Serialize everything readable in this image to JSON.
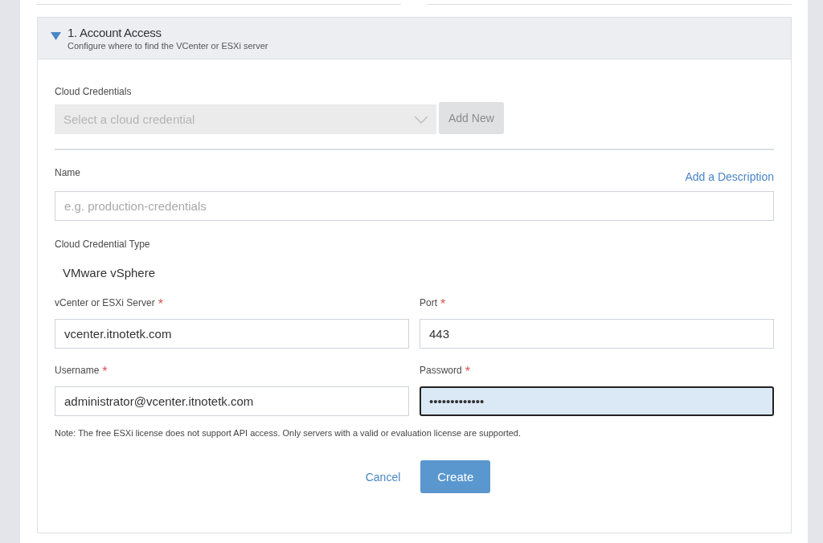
{
  "section": {
    "title": "1. Account Access",
    "subtitle": "Configure where to find the VCenter or ESXi server",
    "expanded": true
  },
  "cloud_credentials": {
    "label": "Cloud Credentials",
    "placeholder": "Select a cloud credential",
    "disabled": true,
    "add_button": {
      "label": "Add New",
      "disabled": true
    }
  },
  "name": {
    "label": "Name",
    "placeholder": "e.g. production-credentials",
    "link": "Add a Description"
  },
  "credential_type": {
    "label": "Cloud Credential Type",
    "value": "VMware vSphere"
  },
  "fields": [
    {
      "label": "vCenter or ESXi Server",
      "required_mark": "*",
      "value": "vcenter.itnotetk.com",
      "focused": false
    },
    {
      "label": "Port",
      "required_mark": "*",
      "value": "443",
      "focused": false
    },
    {
      "label": "Username",
      "required_mark": "*",
      "value": "administrator@vcenter.itnotetk.com",
      "focused": false
    },
    {
      "label": "Password",
      "required_mark": "*",
      "value": "•••••••••••••",
      "focused": true
    }
  ],
  "note": "Note: The free ESXi license does not support API access. Only servers with a valid or evaluation license are supported.",
  "actions": {
    "cancel": "Cancel",
    "create": "Create"
  }
}
